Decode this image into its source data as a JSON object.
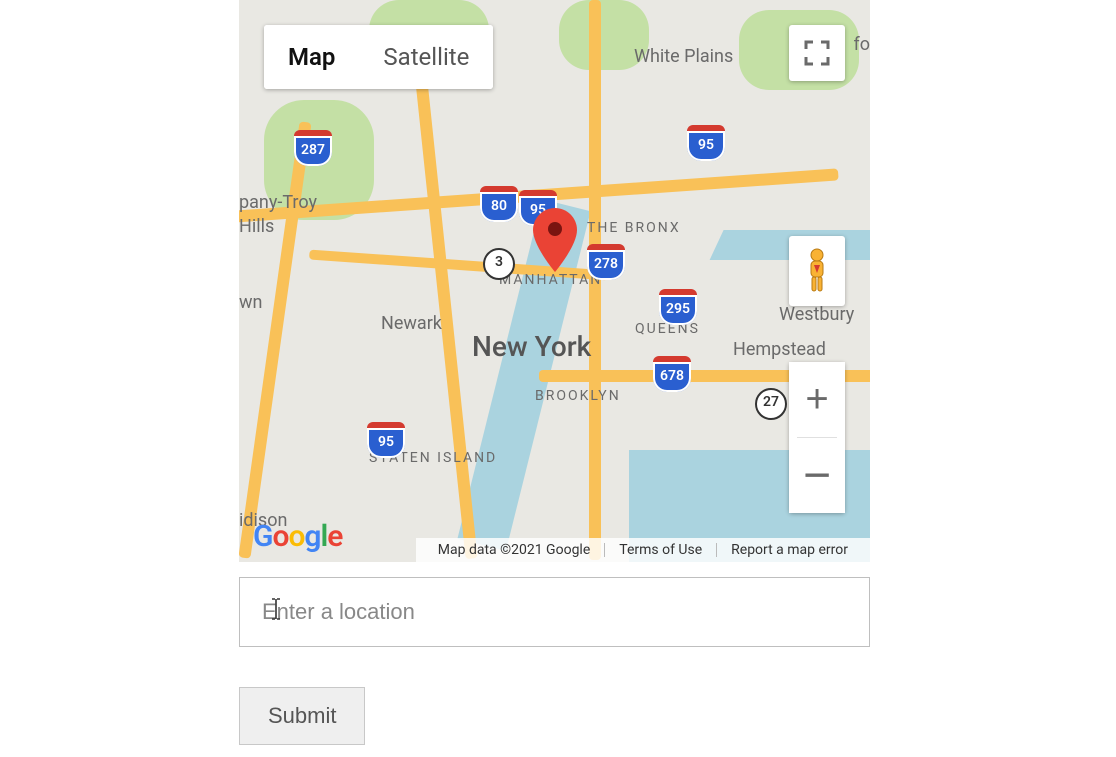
{
  "map_type_control": {
    "map_label": "Map",
    "satellite_label": "Satellite",
    "active": "Map"
  },
  "marker": {
    "title": "New York"
  },
  "places": {
    "white_plains": "White Plains",
    "pany_troy": "pany-Troy",
    "hills": "Hills",
    "wn": "wn",
    "bronx": "THE BRONX",
    "manhattan": "MANHATTAN",
    "newark": "Newark",
    "new_york": "New York",
    "queens": "QUEENS",
    "brooklyn": "BROOKLYN",
    "hempstead": "Hempstead",
    "westbury": "Westbury",
    "idison": "idison",
    "staten_island": "STATEN ISLAND",
    "fo": "fo"
  },
  "shields": {
    "i287": "287",
    "i80": "80",
    "i95a": "95",
    "i95b": "95",
    "i278": "278",
    "i295": "295",
    "i678": "678",
    "i95c": "95",
    "state3": "3",
    "state27": "27"
  },
  "attribution": {
    "map_data": "Map data ©2021 Google",
    "terms": "Terms of Use",
    "report": "Report a map error"
  },
  "google_letters": [
    "G",
    "o",
    "o",
    "g",
    "l",
    "e"
  ],
  "location_input": {
    "placeholder": "Enter a location",
    "value": ""
  },
  "submit_label": "Submit"
}
